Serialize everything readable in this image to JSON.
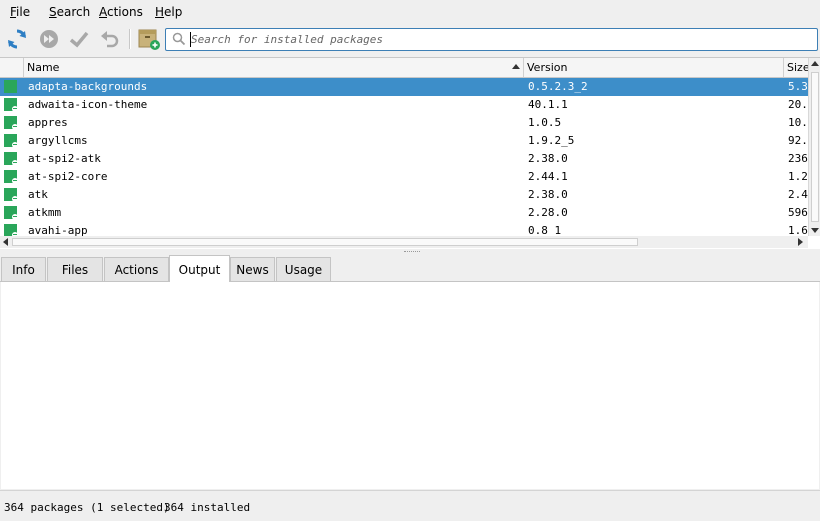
{
  "menu": {
    "file": "File",
    "search": "Search",
    "actions": "Actions",
    "help": "Help"
  },
  "toolbar": {
    "icons": [
      "refresh-icon",
      "fast-forward-icon",
      "apply-checkmark-icon",
      "undo-icon",
      "install-package-icon"
    ]
  },
  "search": {
    "placeholder": "Search for installed packages",
    "value": ""
  },
  "table": {
    "columns": {
      "name": "Name",
      "version": "Version",
      "size": "Size"
    },
    "sort": "name-ascending",
    "rows": [
      {
        "name": "adapta-backgrounds",
        "version": "0.5.2.3_2",
        "size": "5.3",
        "selected": true
      },
      {
        "name": "adwaita-icon-theme",
        "version": "40.1.1",
        "size": "20."
      },
      {
        "name": "appres",
        "version": "1.0.5",
        "size": "10."
      },
      {
        "name": "argyllcms",
        "version": "1.9.2_5",
        "size": "92."
      },
      {
        "name": "at-spi2-atk",
        "version": "2.38.0",
        "size": "236"
      },
      {
        "name": "at-spi2-core",
        "version": "2.44.1",
        "size": "1.2"
      },
      {
        "name": "atk",
        "version": "2.38.0",
        "size": "2.4"
      },
      {
        "name": "atkmm",
        "version": "2.28.0",
        "size": "596"
      },
      {
        "name": "avahi-app",
        "version": "0.8_1",
        "size": "1.6"
      }
    ]
  },
  "tabs": [
    {
      "label": "Info"
    },
    {
      "label": "Files"
    },
    {
      "label": "Actions"
    },
    {
      "label": "Output",
      "active": true
    },
    {
      "label": "News"
    },
    {
      "label": "Usage"
    }
  ],
  "status": {
    "packages": "364 packages (1 selected)",
    "installed": "364 installed"
  },
  "colors": {
    "selection": "#3d8ec9",
    "installed_marker": "#2aa65a",
    "search_focus_border": "#3d7fb5",
    "toolbar_icon_blue": "#2e7fc4"
  }
}
